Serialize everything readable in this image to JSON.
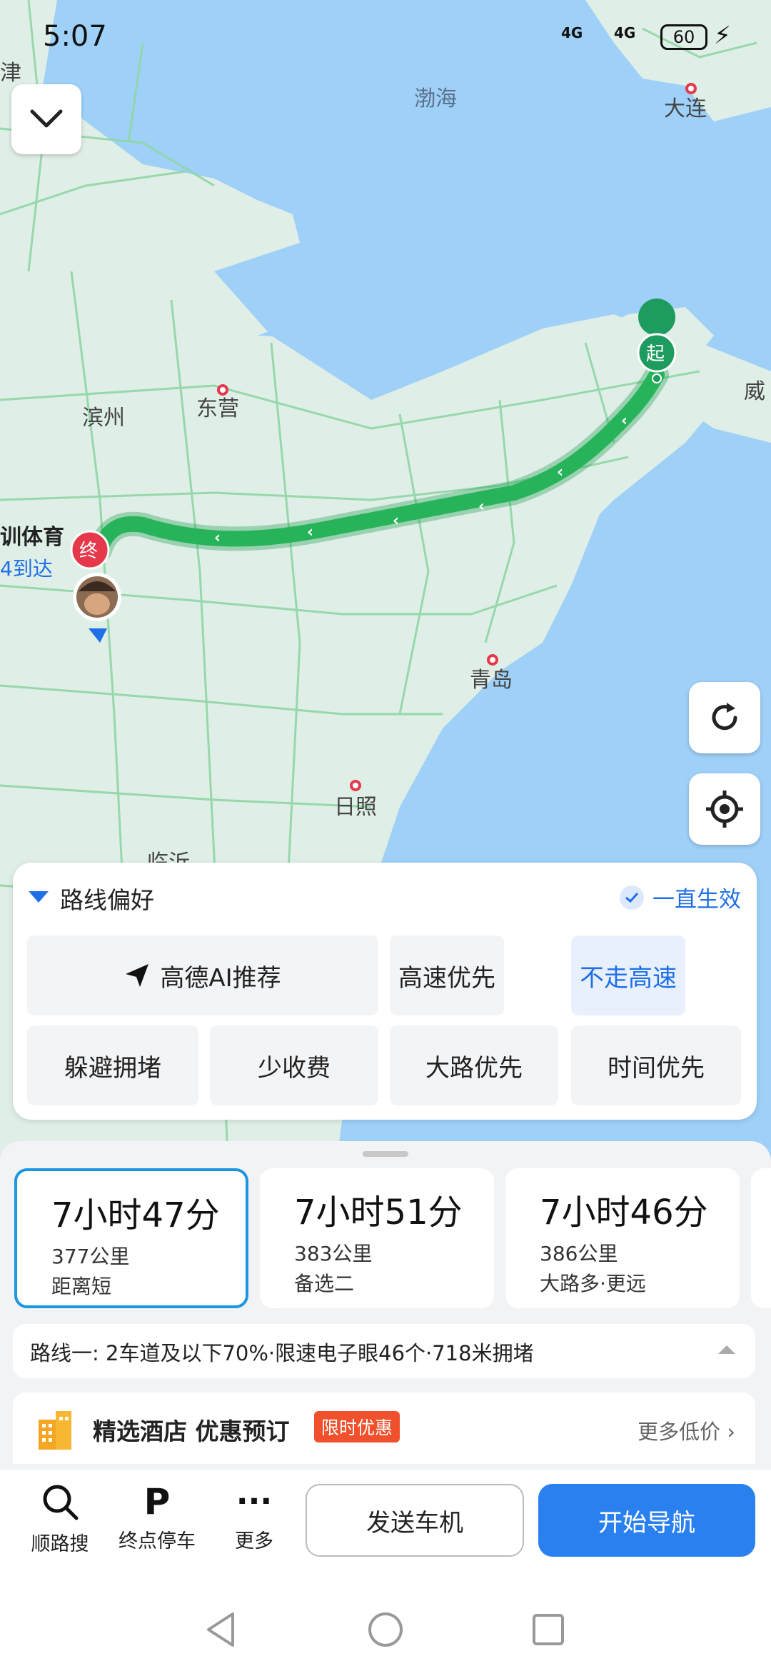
{
  "status_bar": {
    "time": "5:07",
    "signal1": "4G",
    "signal2": "4G",
    "battery": "60"
  },
  "map": {
    "labels": {
      "bohai": "渤海",
      "dalian": "大连",
      "binzhou": "滨州",
      "dongying": "东营",
      "wei": "威",
      "qingdao": "青岛",
      "rizhao": "日照",
      "linyi": "临沂",
      "tiyu": "训体育",
      "arrive": "4到达",
      "left_edge_top": "津"
    },
    "start_marker": "起",
    "end_marker": "终"
  },
  "preference": {
    "title": "路线偏好",
    "always": "一直生效",
    "options": [
      "高德AI推荐",
      "高速优先",
      "不走高速",
      "躲避拥堵",
      "少收费",
      "大路优先",
      "时间优先"
    ],
    "selected": "不走高速"
  },
  "routes": [
    {
      "time": "7小时47分",
      "distance": "377公里",
      "tag": "距离短"
    },
    {
      "time": "7小时51分",
      "distance": "383公里",
      "tag": "备选二"
    },
    {
      "time": "7小时46分",
      "distance": "386公里",
      "tag": "大路多·更远"
    }
  ],
  "route_info": "路线一:  2车道及以下70%·限速电子眼46个·718米拥堵",
  "hotel": {
    "title": "精选酒店 优惠预订",
    "promo": "限时优惠",
    "more": "更多低价"
  },
  "toolbar": {
    "search_label": "顺路搜",
    "parking_label": "终点停车",
    "more_label": "更多",
    "send_label": "发送车机",
    "start_label": "开始导航"
  },
  "colors": {
    "accent": "#2b80f0",
    "route": "#27b35a",
    "start": "#1e9b5e",
    "end": "#e5394b"
  }
}
